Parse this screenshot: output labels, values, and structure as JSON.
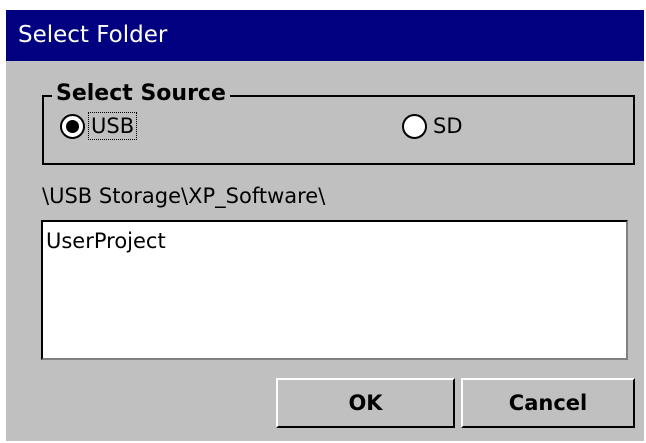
{
  "dialog": {
    "title": "Select Folder",
    "colors": {
      "titlebar_bg": "#000080",
      "titlebar_text": "#ffffff",
      "body_bg": "#c0c0c0",
      "list_bg": "#ffffff"
    }
  },
  "source_group": {
    "label": "Select Source",
    "options": [
      {
        "label": "USB",
        "selected": true
      },
      {
        "label": "SD",
        "selected": false
      }
    ]
  },
  "path": {
    "text": "\\USB Storage\\XP_Software\\"
  },
  "folder_list": {
    "items": [
      "UserProject"
    ]
  },
  "buttons": {
    "ok_label": "OK",
    "cancel_label": "Cancel"
  }
}
